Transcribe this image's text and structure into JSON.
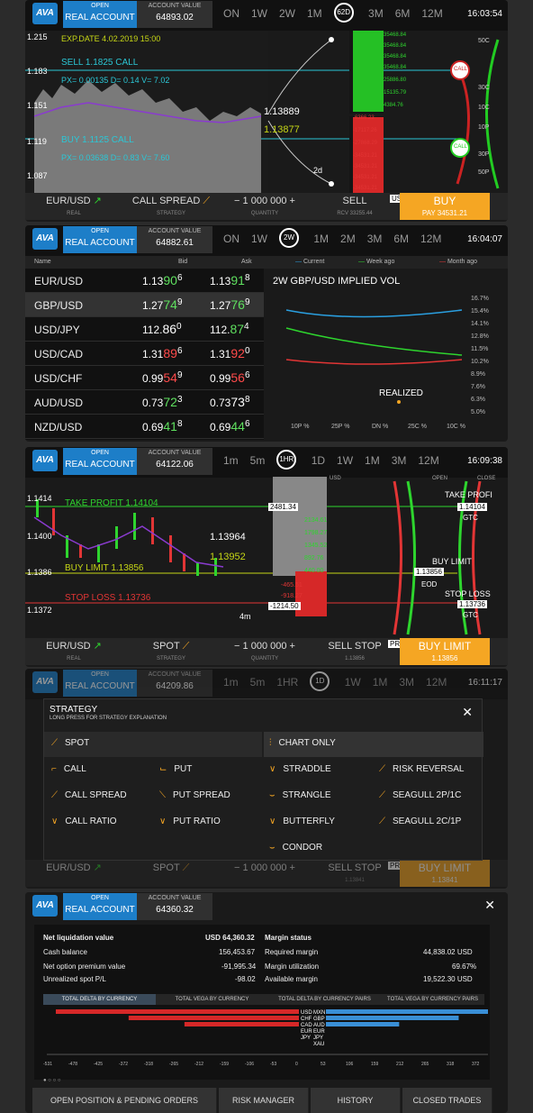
{
  "colors": {
    "accent": "#1d7ec8",
    "buy": "#f5a623",
    "up": "#2ed52e",
    "down": "#e23535",
    "cyan": "#2bc7d6"
  },
  "panels": [
    {
      "open": "OPEN",
      "account_label": "REAL ACCOUNT",
      "acct_value_label": "ACCOUNT VALUE",
      "acct_value": "64893.02",
      "periods": [
        "ON",
        "1W",
        "2W",
        "1M"
      ],
      "selected_period": "62D",
      "periods_after": [
        "3M",
        "6M",
        "12M"
      ],
      "time": "16:03:54",
      "y_ticks": [
        "1.215",
        "1.183",
        "1.151",
        "1.119",
        "1.087"
      ],
      "expdate": "EXP.DATE 4.02.2019 15:00",
      "sell_label": "SELL 1.1825 CALL",
      "sell_px": "PX= 0.00135 D= 0.14 V= 7.02",
      "buy_label": "BUY 1.1125 CALL",
      "buy_px": "PX= 0.03638 D= 0.83 V= 7.60",
      "price_hi": "1.13889",
      "price_lo": "1.13877",
      "green_levels": [
        "35468.84",
        "35468.84",
        "35468.84",
        "35468.84",
        "25886.80",
        "15135.79",
        "4384.76"
      ],
      "red_levels": [
        "-6366.23",
        "-17117.26",
        "-27868.29",
        "-34531.21",
        "-34531.21",
        "-34531.21",
        "-34531.21"
      ],
      "time_label": "2d",
      "pair": "EUR/USD",
      "pair_sub": "REAL",
      "strategy": "CALL SPREAD",
      "strategy_sub": "STRATEGY",
      "quantity": "1 000 000",
      "quantity_sub": "QUANTITY",
      "sell": "SELL",
      "sell_sub": "RCV 33255.44",
      "buy": "BUY",
      "buy_sub": "PAY 34531.21",
      "usd_tag": "USD",
      "call_badge": "CALL",
      "call_badge2": "CALL",
      "strike_labels": [
        "50C",
        "30C",
        "10C",
        "10P",
        "30P",
        "50P"
      ]
    },
    {
      "open": "OPEN",
      "account_label": "REAL ACCOUNT",
      "acct_value_label": "ACCOUNT VALUE",
      "acct_value": "64882.61",
      "periods": [
        "ON",
        "1W"
      ],
      "selected_period": "2W",
      "periods_after": [
        "1M",
        "2M",
        "3M",
        "6M",
        "12M"
      ],
      "time": "16:04:07",
      "headers": {
        "name": "Name",
        "bid": "Bid",
        "ask": "Ask"
      },
      "rows": [
        {
          "pair": "EUR/USD",
          "bid_a": "1.13",
          "bid_b": "90",
          "bid_c": "6",
          "ask_a": "1.13",
          "ask_b": "91",
          "ask_c": "8"
        },
        {
          "pair": "GBP/USD",
          "bid_a": "1.27",
          "bid_b": "74",
          "bid_c": "9",
          "ask_a": "1.27",
          "ask_b": "76",
          "ask_c": "9"
        },
        {
          "pair": "USD/JPY",
          "bid_a": "112.",
          "bid_b": "86",
          "bid_c": "0",
          "ask_a": "112.",
          "ask_b": "87",
          "ask_c": "4"
        },
        {
          "pair": "USD/CAD",
          "bid_a": "1.31",
          "bid_b": "89",
          "bid_c": "6",
          "ask_a": "1.31",
          "ask_b": "92",
          "ask_c": "0"
        },
        {
          "pair": "USD/CHF",
          "bid_a": "0.99",
          "bid_b": "54",
          "bid_c": "9",
          "ask_a": "0.99",
          "ask_b": "56",
          "ask_c": "6"
        },
        {
          "pair": "AUD/USD",
          "bid_a": "0.73",
          "bid_b": "72",
          "bid_c": "3",
          "ask_a": "0.73",
          "ask_b": "73",
          "ask_c": "8"
        },
        {
          "pair": "NZD/USD",
          "bid_a": "0.69",
          "bid_b": "41",
          "bid_c": "8",
          "ask_a": "0.69",
          "ask_b": "44",
          "ask_c": "6"
        }
      ],
      "vol_title": "2W GBP/USD IMPLIED VOL",
      "legend": [
        "Current",
        "Week ago",
        "Month ago"
      ],
      "vol_y": [
        "16.7%",
        "15.4%",
        "14.1%",
        "12.8%",
        "11.5%",
        "10.2%",
        "8.9%",
        "7.6%",
        "6.3%",
        "5.0%"
      ],
      "vol_x": [
        "10P %",
        "25P %",
        "DN %",
        "25C %",
        "10C %"
      ],
      "realized": "REALIZED"
    },
    {
      "open": "OPEN",
      "account_label": "REAL ACCOUNT",
      "acct_value_label": "ACCOUNT VALUE",
      "acct_value": "64122.06",
      "periods": [
        "1m",
        "5m"
      ],
      "selected_period": "1HR",
      "periods_after": [
        "1D",
        "1W",
        "1M",
        "3M",
        "12M"
      ],
      "time": "16:09:38",
      "y_ticks": [
        "1.1414",
        "1.1400",
        "1.1386",
        "1.1372"
      ],
      "take_profit": "TAKE PROFIT 1.14104",
      "buy_limit": "BUY LIMIT 1.13856",
      "stop_loss": "STOP LOSS 1.13736",
      "price_hi": "1.13964",
      "price_lo": "1.13952",
      "pos_levels": [
        "2481.34",
        "2134.61",
        "1798.27",
        "1345.52",
        "892.76",
        "440.00"
      ],
      "neg_levels": [
        "-465.51",
        "-918.27",
        "-1214.50"
      ],
      "time_label": "4m",
      "usd_label": "USD",
      "open_label": "OPEN",
      "close_label": "CLOSE",
      "right_tp": "TAKE PROFI",
      "right_tp_val": "1.14104",
      "right_tp_sub": "GTC",
      "right_bl": "BUY LIMIT",
      "right_bl_val": "1.13856",
      "right_bl_sub": "EOD",
      "right_sl": "STOP LOSS",
      "right_sl_val": "1.13736",
      "right_sl_sub": "GTC",
      "pair": "EUR/USD",
      "pair_sub": "REAL",
      "strategy": "SPOT",
      "strategy_sub": "STRATEGY",
      "quantity": "1 000 000",
      "quantity_sub": "QUANTITY",
      "sell": "SELL STOP",
      "sell_sub": "1.13856",
      "buy": "BUY LIMIT",
      "buy_sub": "1.13856",
      "price_tag": "PRICE"
    },
    {
      "open": "OPEN",
      "account_label": "REAL ACCOUNT",
      "acct_value_label": "ACCOUNT VALUE",
      "acct_value": "64209.86",
      "periods": [
        "1m",
        "5m",
        "1HR"
      ],
      "selected_period": "1D",
      "periods_after": [
        "1W",
        "1M",
        "3M",
        "12M"
      ],
      "time": "16:11:17",
      "modal_title": "STRATEGY",
      "modal_sub": "LONG PRESS FOR STRATEGY EXPLANATION",
      "strategies": [
        "SPOT",
        "CHART ONLY",
        "CALL",
        "PUT",
        "STRADDLE",
        "RISK REVERSAL",
        "CALL SPREAD",
        "PUT SPREAD",
        "STRANGLE",
        "SEAGULL 2P/1C",
        "CALL RATIO",
        "PUT RATIO",
        "BUTTERFLY",
        "SEAGULL 2C/1P",
        "CONDOR"
      ],
      "pair": "EUR/USD",
      "strategy": "SPOT",
      "quantity": "1 000 000",
      "sell": "SELL STOP",
      "sell_sub": "1.13841",
      "buy": "BUY LIMIT",
      "buy_sub": "1.13841",
      "price_tag": "PRICE"
    },
    {
      "open": "OPEN",
      "account_label": "REAL ACCOUNT",
      "acct_value_label": "ACCOUNT VALUE",
      "acct_value": "64360.32",
      "left": [
        {
          "k": "Net liquidation value",
          "v": "USD 64,360.32"
        },
        {
          "k": "Cash balance",
          "v": "156,453.67"
        },
        {
          "k": "Net option premium value",
          "v": "-91,995.34"
        },
        {
          "k": "Unrealized spot P/L",
          "v": "-98.02"
        }
      ],
      "right": [
        {
          "k": "Margin status",
          "v": ""
        },
        {
          "k": "Required margin",
          "v": "44,838.02 USD"
        },
        {
          "k": "Margin utilization",
          "v": "69.67%"
        },
        {
          "k": "Available margin",
          "v": "19,522.30 USD"
        }
      ],
      "delta_tabs": [
        "TOTAL DELTA BY CURRENCY",
        "TOTAL VEGA BY CURRENCY",
        "TOTAL DELTA BY CURRENCY PAIRS",
        "TOTAL VEGA BY CURRENCY PAIRS"
      ],
      "chart_data": {
        "type": "bar",
        "categories": [
          "USD",
          "CHF",
          "CAD",
          "EUR",
          "JPY",
          "MXN",
          "GBP",
          "AUD",
          "XAU"
        ],
        "values": [
          -531,
          -372,
          -250,
          0,
          0,
          372,
          290,
          160,
          0
        ],
        "x_ticks": [
          "-531",
          "-478",
          "-425",
          "-372",
          "-318",
          "-265",
          "-212",
          "-159",
          "-106",
          "-53",
          "0",
          "53",
          "106",
          "159",
          "212",
          "265",
          "318",
          "372"
        ]
      },
      "tabs": [
        "OPEN POSITION & PENDING ORDERS",
        "RISK MANAGER",
        "HISTORY",
        "CLOSED TRADES"
      ]
    }
  ]
}
